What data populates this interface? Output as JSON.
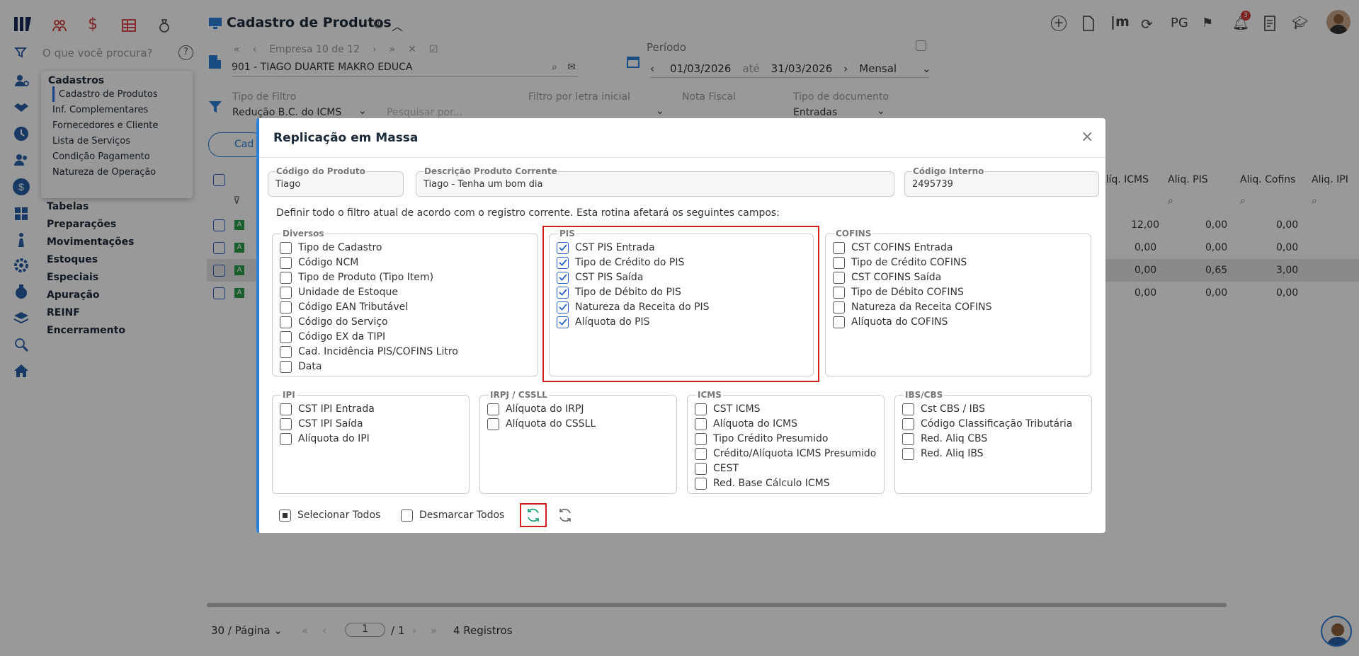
{
  "header": {
    "title": "Cadastro de Produtos",
    "info_icon": "info-icon",
    "notification_count": "3",
    "pg_label": "PG"
  },
  "search": {
    "placeholder": "O que você procura?"
  },
  "company": {
    "label": "Empresa 10 de 12",
    "value": "901 - TIAGO DUARTE MAKRO EDUCA"
  },
  "period": {
    "label": "Período",
    "from": "01/03/2026",
    "to_word": "até",
    "to": "31/03/2026",
    "mode": "Mensal"
  },
  "filters": {
    "filter_type_label": "Tipo de Filtro",
    "filter_type_value": "Redução B.C. do ICMS",
    "search_placeholder": "Pesquisar por...",
    "letter_label": "Filtro por letra inicial",
    "nota_label": "Nota Fiscal",
    "doc_type_label": "Tipo de documento",
    "doc_type_value": "Entradas"
  },
  "cad_button_label": "Cad",
  "side_menu": {
    "title": "Cadastros",
    "items": [
      "Cadastro de Produtos",
      "Inf. Complementares",
      "Fornecedores e Cliente",
      "Lista de Serviços",
      "Condição Pagamento",
      "Natureza de Operação"
    ]
  },
  "main_menu": [
    "Tabelas",
    "Preparações",
    "Movimentações",
    "Estoques",
    "Especiais",
    "Apuração",
    "REINF",
    "Encerramento"
  ],
  "table": {
    "columns": [
      "Alíq. ICMS",
      "Aliq. PIS",
      "Aliq. Cofins",
      "Aliq. IPI"
    ],
    "row_badge": "A",
    "rows": [
      [
        "12,00",
        "0,00",
        "0,00"
      ],
      [
        "0,00",
        "0,00",
        "0,00"
      ],
      [
        "0,00",
        "0,65",
        "3,00"
      ],
      [
        "0,00",
        "0,00",
        "0,00"
      ]
    ]
  },
  "pagination": {
    "per_page": "30 / Página",
    "page": "1",
    "total": "/ 1",
    "records": "4 Registros"
  },
  "modal": {
    "title": "Replicação em Massa",
    "close": "×",
    "fields": {
      "codigo_label": "Código do Produto",
      "codigo_value": "Tiago",
      "desc_label": "Descrição Produto Corrente",
      "desc_value": "Tiago - Tenha um bom dia",
      "interno_label": "Código Interno",
      "interno_value": "2495739"
    },
    "description": "Definir todo o filtro atual de acordo com o registro corrente. Esta rotina afetará os seguintes campos:",
    "groups": {
      "diversos": {
        "label": "Diversos",
        "items": [
          "Tipo de Cadastro",
          "Código NCM",
          "Tipo de Produto (Tipo Item)",
          "Unidade de Estoque",
          "Código EAN Tributável",
          "Código do Serviço",
          "Código EX da TIPI",
          "Cad. Incidência PIS/COFINS Litro",
          "Data"
        ]
      },
      "pis": {
        "label": "PIS",
        "items": [
          "CST PIS Entrada",
          "Tipo de Crédito do PIS",
          "CST PIS Saída",
          "Tipo de Débito do PIS",
          "Natureza da Receita do PIS",
          "Alíquota do PIS"
        ]
      },
      "cofins": {
        "label": "COFINS",
        "items": [
          "CST COFINS Entrada",
          "Tipo de Crédito COFINS",
          "CST COFINS Saída",
          "Tipo de Débito COFINS",
          "Natureza da Receita COFINS",
          "Alíquota do COFINS"
        ]
      },
      "ipi": {
        "label": "IPI",
        "items": [
          "CST IPI Entrada",
          "CST IPI Saída",
          "Alíquota do IPI"
        ]
      },
      "irpj": {
        "label": "IRPJ / CSSLL",
        "items": [
          "Alíquota do IRPJ",
          "Alíquota do CSSLL"
        ]
      },
      "icms": {
        "label": "ICMS",
        "items": [
          "CST ICMS",
          "Alíquota do ICMS",
          "Tipo Crédito Presumido",
          "Crédito/Alíquota ICMS Presumido",
          "CEST",
          "Red. Base Cálculo ICMS"
        ]
      },
      "ibs": {
        "label": "IBS/CBS",
        "items": [
          "Cst CBS / IBS",
          "Código Classificação Tributária",
          "Red. Aliq CBS",
          "Red. Aliq IBS"
        ]
      }
    },
    "select_all": "Selecionar Todos",
    "unselect_all": "Desmarcar Todos"
  }
}
